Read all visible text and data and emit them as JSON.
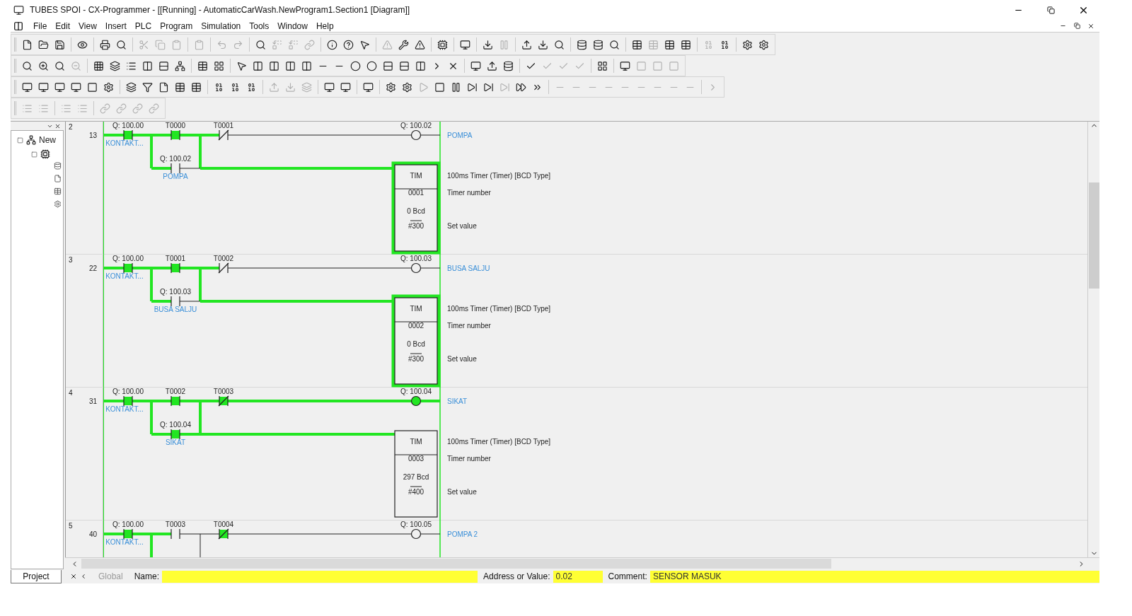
{
  "window": {
    "title": "TUBES SPOI - CX-Programmer - [[Running] - AutomaticCarWash.NewProgram1.Section1 [Diagram]]"
  },
  "menu": [
    "File",
    "Edit",
    "View",
    "Insert",
    "PLC",
    "Program",
    "Simulation",
    "Tools",
    "Window",
    "Help"
  ],
  "project_tree": {
    "root": "New",
    "tab": "Project"
  },
  "rungs": [
    {
      "number": "2",
      "step": "13",
      "contacts": [
        {
          "kind": "no",
          "address": "Q: 100.00",
          "comment": "KONTAKT...",
          "on": true
        },
        {
          "kind": "no",
          "address": "T0000",
          "on": true
        },
        {
          "kind": "nc",
          "address": "T0001",
          "on": false
        }
      ],
      "branch": {
        "kind": "no",
        "address": "Q: 100.02",
        "comment": "POMPA",
        "on": false
      },
      "coil": {
        "address": "Q: 100.02",
        "comment": "POMPA",
        "on": false
      },
      "timer": {
        "on": true,
        "name": "TIM",
        "number": "0001",
        "present": "0 Bcd",
        "set": "#300",
        "description": "100ms Timer (Timer) [BCD Type]",
        "number_label": "Timer number",
        "set_label": "Set value"
      }
    },
    {
      "number": "3",
      "step": "22",
      "contacts": [
        {
          "kind": "no",
          "address": "Q: 100.00",
          "comment": "KONTAKT...",
          "on": true
        },
        {
          "kind": "no",
          "address": "T0001",
          "on": true
        },
        {
          "kind": "nc",
          "address": "T0002",
          "on": false
        }
      ],
      "branch": {
        "kind": "no",
        "address": "Q: 100.03",
        "comment": "BUSA SALJU",
        "on": false
      },
      "coil": {
        "address": "Q: 100.03",
        "comment": "BUSA SALJU",
        "on": false
      },
      "timer": {
        "on": true,
        "name": "TIM",
        "number": "0002",
        "present": "0 Bcd",
        "set": "#300",
        "description": "100ms Timer (Timer) [BCD Type]",
        "number_label": "Timer number",
        "set_label": "Set value"
      }
    },
    {
      "number": "4",
      "step": "31",
      "contacts": [
        {
          "kind": "no",
          "address": "Q: 100.00",
          "comment": "KONTAKT...",
          "on": true
        },
        {
          "kind": "no",
          "address": "T0002",
          "on": true
        },
        {
          "kind": "nc",
          "address": "T0003",
          "on": true
        }
      ],
      "branch": {
        "kind": "no",
        "address": "Q: 100.04",
        "comment": "SIKAT",
        "on": true
      },
      "coil": {
        "address": "Q: 100.04",
        "comment": "SIKAT",
        "on": true
      },
      "timer": {
        "on": false,
        "name": "TIM",
        "number": "0003",
        "present": "297 Bcd",
        "set": "#400",
        "description": "100ms Timer (Timer) [BCD Type]",
        "number_label": "Timer number",
        "set_label": "Set value"
      }
    },
    {
      "number": "5",
      "step": "40",
      "contacts": [
        {
          "kind": "no",
          "address": "Q: 100.00",
          "comment": "KONTAKT...",
          "on": true
        },
        {
          "kind": "no",
          "address": "T0003",
          "on": false
        },
        {
          "kind": "nc",
          "address": "T0004",
          "on": true
        }
      ],
      "coil": {
        "address": "Q: 100.05",
        "comment": "POMPA 2",
        "on": false
      }
    }
  ],
  "status_bar": {
    "scope_tab": "Global",
    "name_label": "Name:",
    "address_label": "Address or Value:",
    "address_value": "0.02",
    "comment_label": "Comment:",
    "comment_value": "SENSOR MASUK"
  }
}
